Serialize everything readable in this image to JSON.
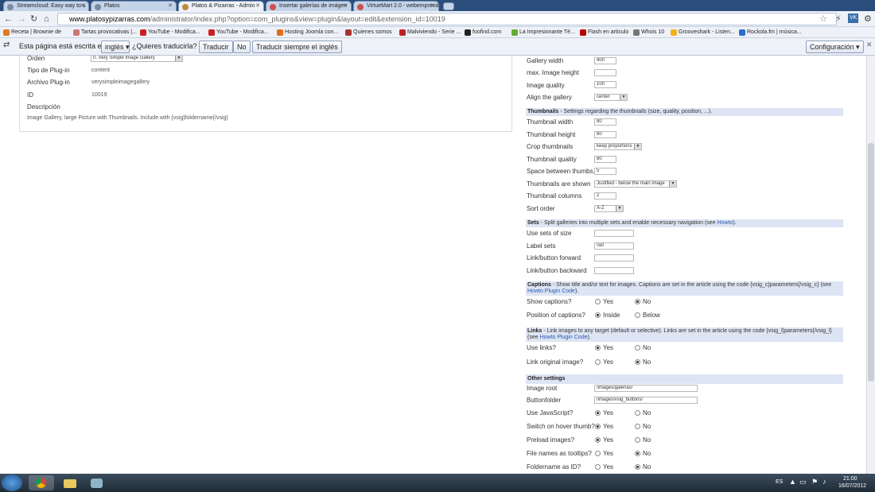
{
  "tabs": [
    {
      "label": "Streamcloud: Easy way to s",
      "active": false
    },
    {
      "label": "Platos",
      "active": false
    },
    {
      "label": "Platos & Pizarras - Admin",
      "active": true
    },
    {
      "label": "Insertar galerías de imágen",
      "active": false
    },
    {
      "label": "VirtueMart 2.0 - webemprend",
      "active": false
    }
  ],
  "url": {
    "host": "www.platosypizarras.com",
    "path": "/administrator/index.php?option=com_plugins&view=plugin&layout=edit&extension_id=10019"
  },
  "bookmarks": [
    {
      "label": "Receta | Brownie de"
    },
    {
      "label": "Tartas provocativas |..."
    },
    {
      "label": "YouTube - Modifica..."
    },
    {
      "label": "YouTube - Modifica..."
    },
    {
      "label": "Hosting Joomla con..."
    },
    {
      "label": "Quienes somos"
    },
    {
      "label": "Malviviendo - Serie ..."
    },
    {
      "label": "foofind.com"
    },
    {
      "label": "La Impresionante Té..."
    },
    {
      "label": "Flash en articulo"
    },
    {
      "label": "Whois 10"
    },
    {
      "label": "Grooveshark - Listen..."
    },
    {
      "label": "Rockola.fm | música..."
    }
  ],
  "translate": {
    "prefix": "Esta página está escrita en",
    "language": "inglés",
    "question": "¿Quieres traducirla?",
    "translate_btn": "Traducir",
    "no_btn": "No",
    "always_btn": "Traducir siempre el inglés",
    "config_btn": "Configuración"
  },
  "left": {
    "order_label": "Orden",
    "order_value": "0. Very Simple Image Gallery",
    "type_label": "Tipo de Plug-in",
    "type_value": "content",
    "file_label": "Archivo Plug-in",
    "file_value": "verysimpleimagegallery",
    "id_label": "ID",
    "id_value": "10019",
    "desc_label": "Descripción",
    "desc_value": "Image Gallery, large Picture with Thumbnails. Include with {vsig}foldername{/vsig}"
  },
  "gallery": {
    "width_label": "Gallery width",
    "width_value": "400",
    "maxh_label": "max. Image height",
    "maxh_value": "",
    "quality_label": "Image quality",
    "quality_value": "100",
    "align_label": "Align the gallery",
    "align_value": "center"
  },
  "thumbs_header": {
    "title": "Thumbnails",
    "desc": " - Settings regarding the thumbnails (size, quality, position, ...)."
  },
  "thumbs": {
    "width_label": "Thumbnail width",
    "width_value": "80",
    "height_label": "Thumbnail height",
    "height_value": "60",
    "crop_label": "Crop thumbnails",
    "crop_value": "keep proportions",
    "quality_label": "Thumbnail quality",
    "quality_value": "80",
    "space_label": "Space between thumbs.",
    "space_value": "5",
    "shown_label": "Thumbnails are shown",
    "shown_value": "Justified - below the main image",
    "columns_label": "Thumbnail columns",
    "columns_value": "2",
    "sort_label": "Sort order",
    "sort_value": "A-Z"
  },
  "sets_header": {
    "title": "Sets",
    "desc": " - Split galleries into multiple sets and enable necessary navigation (see ",
    "link": "Howto",
    "end": ")."
  },
  "sets": {
    "size_label": "Use sets of size",
    "size_value": "",
    "label_label": "Label sets",
    "label_value": "Set",
    "fwd_label": "Link/button forward",
    "fwd_value": "",
    "back_label": "Link/button backward",
    "back_value": ""
  },
  "captions_header": {
    "title": "Captions",
    "desc": " - Show title and/or text for images. Captions are set in the article using the code {vsig_c}parameters{/vsig_c} (see ",
    "link": "Howto Plugin Code",
    "end": ")."
  },
  "captions": {
    "show_label": "Show captions?",
    "show_yes": "Yes",
    "show_no": "No",
    "pos_label": "Position of captions?",
    "pos_inside": "Inside",
    "pos_below": "Below"
  },
  "links_header": {
    "title": "Links",
    "desc": " - Link images to any target (default or selective). Links are set in the article using the code {vsig_l}parameters{/vsig_l} (see ",
    "link": "Howto Plugin Code",
    "end": ")."
  },
  "links": {
    "use_label": "Use links?",
    "use_yes": "Yes",
    "use_no": "No",
    "orig_label": "Link original image?",
    "orig_yes": "Yes",
    "orig_no": "No"
  },
  "other_header": {
    "title": "Other settings"
  },
  "other": {
    "root_label": "Image root",
    "root_value": "/images/galerias/",
    "btn_label": "Buttonfolder",
    "btn_value": "/images/vsig_buttons/",
    "js_label": "Use JavaScript?",
    "js_yes": "Yes",
    "js_no": "No",
    "hover_label": "Switch on hover thumb?",
    "hover_yes": "Yes",
    "hover_no": "No",
    "preload_label": "Preload images?",
    "preload_yes": "Yes",
    "preload_no": "No",
    "tooltips_label": "File names as tooltips?",
    "tooltips_yes": "Yes",
    "tooltips_no": "No",
    "folder_label": "Foldername as ID?",
    "folder_yes": "Yes",
    "folder_no": "No"
  },
  "tray": {
    "lang": "ES",
    "time": "21:00",
    "date": "16/07/2012"
  }
}
